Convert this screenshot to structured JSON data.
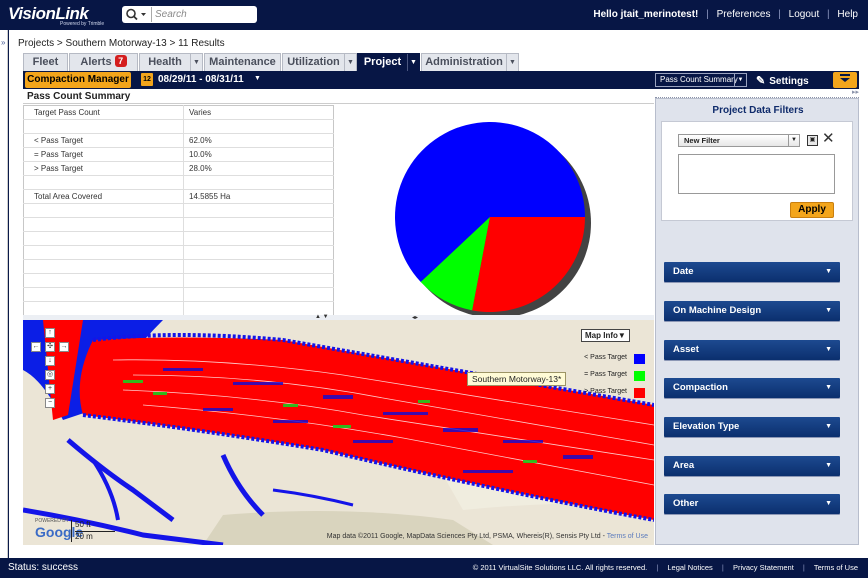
{
  "header": {
    "logo": "VisionLink",
    "logo_sub": "Powered by Trimble",
    "search_placeholder": "Search",
    "greeting": "Hello jtait_merinotest!",
    "links": [
      "Preferences",
      "Logout",
      "Help"
    ]
  },
  "breadcrumb": "Projects > Southern Motorway-13 > 11 Results",
  "tabs": [
    {
      "label": "Fleet"
    },
    {
      "label": "Alerts",
      "badge": "7"
    },
    {
      "label": "Health"
    },
    {
      "label": "Maintenance"
    },
    {
      "label": "Utilization"
    },
    {
      "label": "Project",
      "active": true
    },
    {
      "label": "Administration"
    }
  ],
  "subbar": {
    "mode_button": "Compaction Manager",
    "calendar_day": "12",
    "date_range": "08/29/11 - 08/31/11",
    "view_select": "Pass Count Summary",
    "settings_label": "Settings"
  },
  "summary": {
    "title": "Pass Count Summary",
    "rows": [
      {
        "label": "Target Pass Count",
        "value": "Varies"
      },
      {
        "label": "",
        "value": ""
      },
      {
        "label": "< Pass Target",
        "value": "62.0%"
      },
      {
        "label": "= Pass Target",
        "value": "10.0%"
      },
      {
        "label": "> Pass Target",
        "value": "28.0%"
      },
      {
        "label": "",
        "value": ""
      },
      {
        "label": "Total Area Covered",
        "value": "14.5855 Ha"
      },
      {
        "label": "",
        "value": ""
      },
      {
        "label": "",
        "value": ""
      },
      {
        "label": "",
        "value": ""
      },
      {
        "label": "",
        "value": ""
      },
      {
        "label": "",
        "value": ""
      },
      {
        "label": "",
        "value": ""
      },
      {
        "label": "",
        "value": ""
      },
      {
        "label": "",
        "value": ""
      }
    ]
  },
  "chart_data": {
    "type": "pie",
    "categories": [
      "< Pass Target",
      "= Pass Target",
      "> Pass Target"
    ],
    "values": [
      62.0,
      10.0,
      28.0
    ],
    "colors": [
      "#0000ff",
      "#00ff00",
      "#ff0000"
    ],
    "title": ""
  },
  "map": {
    "info_button": "Map Info",
    "tooltip": "Southern Motorway-13*",
    "legend": [
      {
        "label": "< Pass Target",
        "color": "#0000ff"
      },
      {
        "label": "= Pass Target",
        "color": "#00ff00"
      },
      {
        "label": "> Pass Target",
        "color": "#ff0000"
      }
    ],
    "scale_ft": "50 ft",
    "scale_m": "20 m",
    "google_small": "POWERED BY",
    "google_logo": "Google",
    "copyright": "Map data ©2011  Google, MapData Sciences Pty Ltd, PSMA, Whereis(R), Sensis Pty Ltd - ",
    "terms": "Terms of Use"
  },
  "filters": {
    "title": "Project Data Filters",
    "filter_select": "New Filter",
    "apply": "Apply",
    "sections": [
      "Date",
      "On Machine Design",
      "Asset",
      "Compaction",
      "Elevation Type",
      "Area",
      "Other"
    ]
  },
  "footer": {
    "status": "Status: success",
    "copyright": "© 2011 VirtualSite Solutions LLC. All rights reserved.",
    "links": [
      "Legal Notices",
      "Privacy Statement",
      "Terms of Use"
    ]
  }
}
